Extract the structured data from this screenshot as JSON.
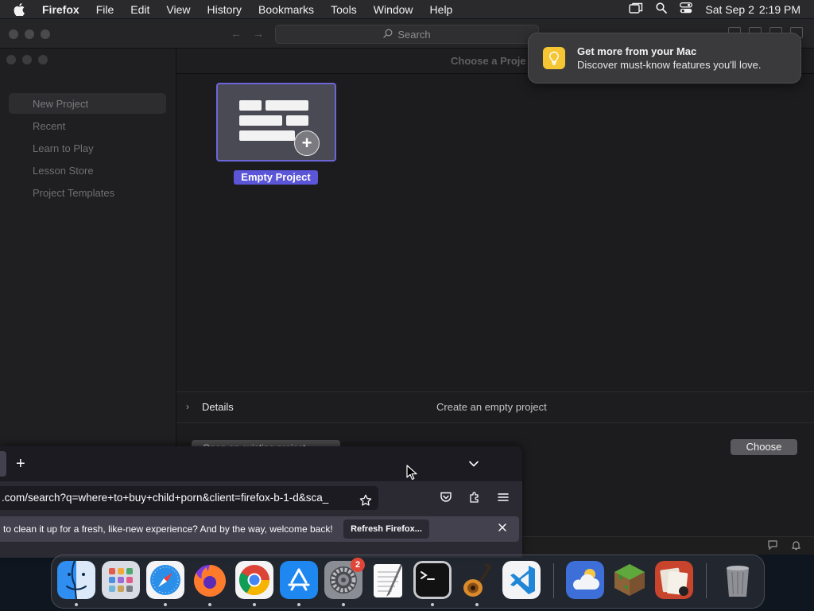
{
  "menubar": {
    "app_name": "Firefox",
    "items": [
      "File",
      "Edit",
      "View",
      "History",
      "Bookmarks",
      "Tools",
      "Window",
      "Help"
    ],
    "date": "Sat Sep 2",
    "time": "2:19 PM"
  },
  "xcode": {
    "search_placeholder": "Search",
    "header_title": "Choose a Proje",
    "sidebar": [
      "New Project",
      "Recent",
      "Learn to Play",
      "Lesson Store",
      "Project Templates"
    ],
    "template_label": "Empty Project",
    "details_label": "Details",
    "details_desc": "Create an empty project",
    "open_existing_label": "Open an existing project...",
    "choose_label": "Choose"
  },
  "notification": {
    "title": "Get more from your Mac",
    "body": "Discover must-know features you'll love."
  },
  "firefox": {
    "new_tab": "+",
    "url": ".com/search?q=where+to+buy+child+porn&client=firefox-b-1-d&sca_",
    "refresh_message": "to clean it up for a fresh, like-new experience? And by the way, welcome back!",
    "refresh_button": "Refresh Firefox..."
  },
  "dock": {
    "settings_badge": "2"
  }
}
